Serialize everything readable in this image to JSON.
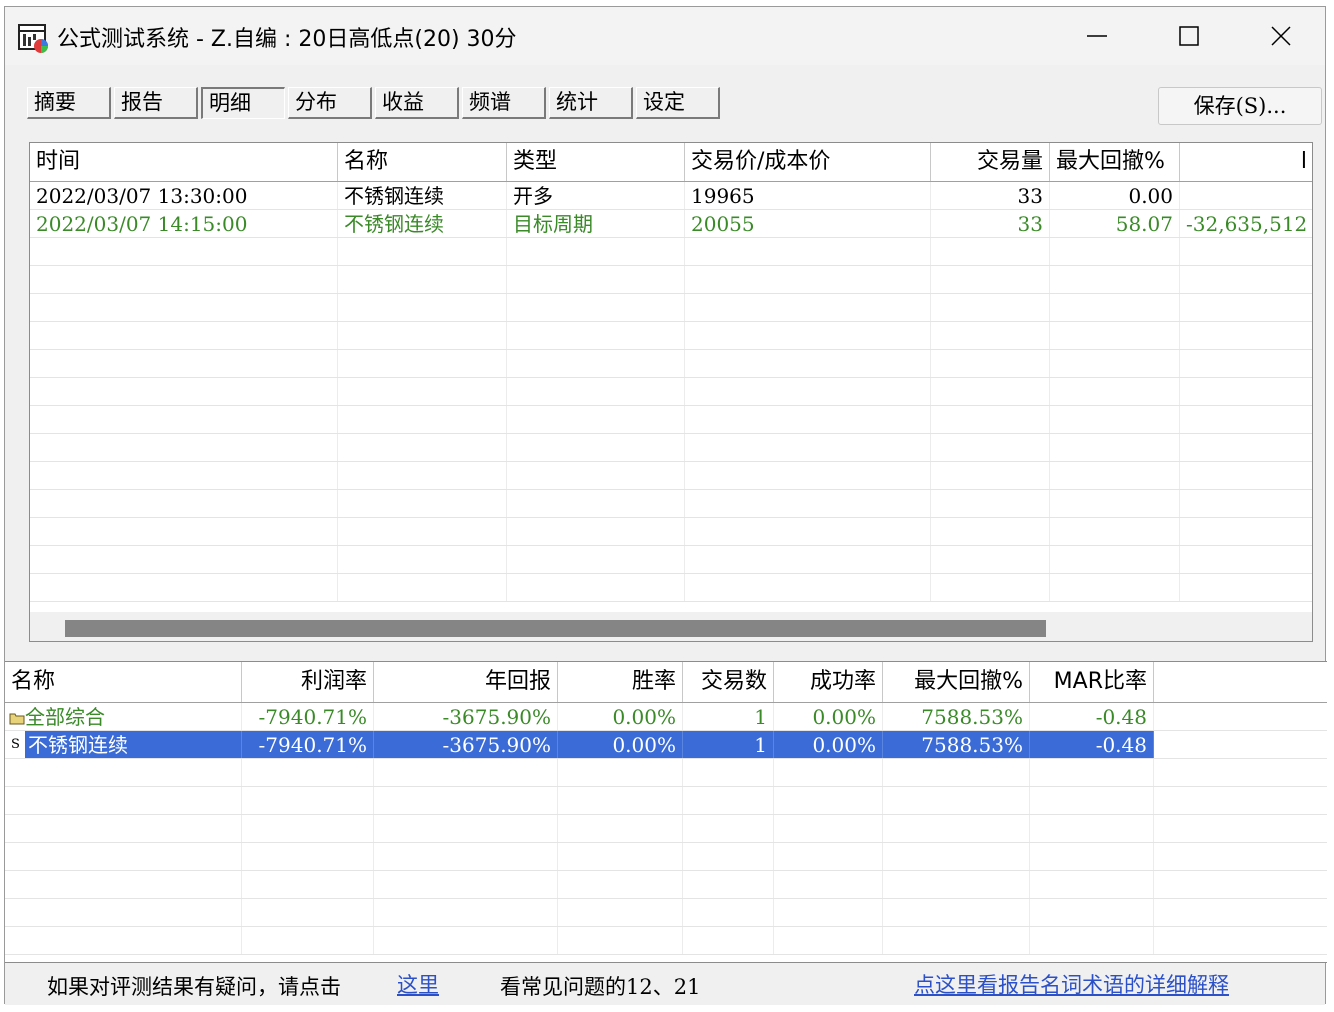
{
  "window": {
    "title": "公式测试系统 - Z.自编 : 20日高低点(20) 30分"
  },
  "tabs": [
    "摘要",
    "报告",
    "明细",
    "分布",
    "收益",
    "频谱",
    "统计",
    "设定"
  ],
  "active_tab": "明细",
  "save_button": "保存(S)...",
  "detail_table": {
    "headers": [
      "时间",
      "名称",
      "类型",
      "交易价/成本价",
      "交易量",
      "最大回撤%",
      "l"
    ],
    "rows": [
      {
        "time": "2022/03/07 13:30:00",
        "name": "不锈钢连续",
        "type": "开多",
        "price": "19965",
        "volume": "33",
        "drawdown": "0.00",
        "extra": ""
      },
      {
        "time": "2022/03/07 14:15:00",
        "name": "不锈钢连续",
        "type": "目标周期",
        "price": "20055",
        "volume": "33",
        "drawdown": "58.07",
        "extra": "-32,635,512"
      }
    ]
  },
  "summary_table": {
    "headers": [
      "名称",
      "利润率",
      "年回报",
      "胜率",
      "交易数",
      "成功率",
      "最大回撤%",
      "MAR比率"
    ],
    "rows": [
      {
        "icon": "folder-icon",
        "name": "全部综合",
        "profit": "-7940.71%",
        "annual": "-3675.90%",
        "winrate": "0.00%",
        "trades": "1",
        "success": "0.00%",
        "drawdown": "7588.53%",
        "mar": "-0.48"
      },
      {
        "icon": "S",
        "name": "不锈钢连续",
        "profit": "-7940.71%",
        "annual": "-3675.90%",
        "winrate": "0.00%",
        "trades": "1",
        "success": "0.00%",
        "drawdown": "7588.53%",
        "mar": "-0.48"
      }
    ]
  },
  "footer": {
    "question_text": "如果对评测结果有疑问，请点击",
    "question_link": "这里",
    "faq_text": "看常见问题的12、21",
    "glossary_link": "点这里看报告名词术语的详细解释"
  },
  "colors": {
    "selection": "#3a6bd6",
    "positive_green": "#3a8a28",
    "link_blue": "#2b50c8"
  }
}
